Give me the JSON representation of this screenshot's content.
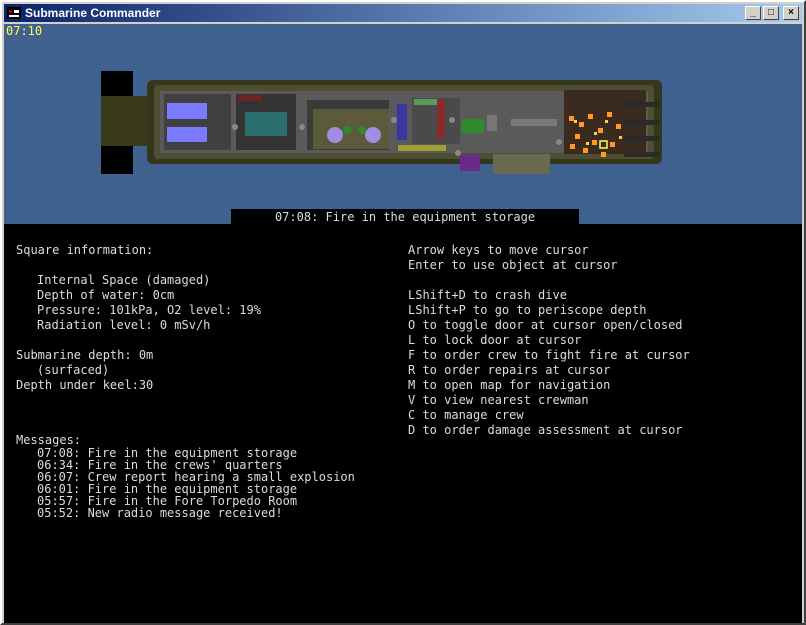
{
  "window": {
    "title": "Submarine Commander",
    "minimize": "_",
    "maximize": "□",
    "close": "×"
  },
  "clock": "07:10",
  "banner": "07:08: Fire in the equipment storage",
  "square_info": {
    "heading": "Square information:",
    "name": "Internal Space (damaged)",
    "water": "Depth of water: 0cm",
    "pressure": "Pressure: 101kPa, O2 level: 19%",
    "radiation": "Radiation level: 0 mSv/h"
  },
  "submarine": {
    "depth": "Submarine depth: 0m",
    "state": "(surfaced)",
    "keel": "Depth under keel:30"
  },
  "messages": {
    "heading": "Messages:",
    "items": [
      "07:08: Fire in the equipment storage",
      "06:34: Fire in the crews' quarters",
      "06:07: Crew report hearing a small explosion",
      "06:01: Fire in the equipment storage",
      "05:57: Fire in the Fore Torpedo Room",
      "05:52: New radio message received!"
    ]
  },
  "help": {
    "cursor": [
      "Arrow keys to move cursor",
      "Enter to use object at cursor"
    ],
    "commands": [
      "LShift+D to crash dive",
      "LShift+P to go to periscope depth",
      "O to toggle door at cursor open/closed",
      "L to lock door at cursor",
      "F to order crew to fight fire at cursor",
      "R to order repairs at cursor",
      "M to open map for navigation",
      "V to view nearest crewman",
      "C to manage crew",
      "D to order damage assessment at cursor"
    ]
  },
  "colors": {
    "sea": "#3f6190",
    "text": "#dcdcdc",
    "clock": "#ffff40",
    "fire": "#ff9a1a"
  }
}
